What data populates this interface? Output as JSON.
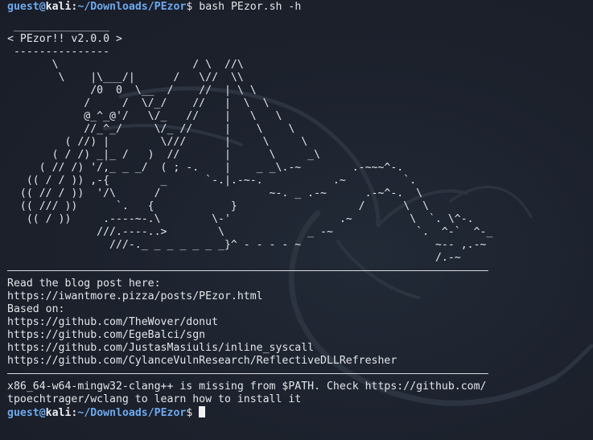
{
  "prompt": {
    "user": "guest",
    "at": "@",
    "host": "kali",
    "sep": ":",
    "path": "~/Downloads/PEzor",
    "symbol": "$"
  },
  "command": " bash PEzor.sh -h",
  "banner_art": " _______________\n< PEzor!! v2.0.0 >\n ---------------\n       \\                     / \\  //\\\n        \\    |\\___/|      /   \\//  \\\\\n             /0  0  \\__  /    //  | \\ \\\n            /     /  \\/_/    //   |  \\  \\\n            @_^_@'/   \\/_   //    |   \\   \\\n            //_^_/     \\/_ //     |    \\    \\\n         ( //) |        \\///      |     \\     \\\n       ( / /) _|_ /   )  //       |      \\     _\\\n     ( // /) '/,_ _ _/  ( ; -.    |    _ _\\.-~        .-~~~^-.\n   (( / / )) ,-{        _      `-.|.-~-.           .~         `.\n  (( // / ))  '/\\      /                 ~-. _ .-~      .-~^-.  \\\n  (( /// ))      `.   {            }                   /      \\  \\\n   (( / ))     .----~-.\\        \\-'                 .~         \\  `. \\^-.\n              ///.----..>        \\             _ -~             `.  ^-`  ^-_\n                ///-._ _ _ _ _ _ _}^ - - - - ~                     ~-- ,.-~\n                                                                   /.-~",
  "blog_header": "Read the blog post here:",
  "blog_url": "https://iwantmore.pizza/posts/PEzor.html",
  "based_on_label": "Based on:",
  "based_on": [
    "https://github.com/TheWover/donut",
    "https://github.com/EgeBalci/sgn",
    "https://github.com/JustasMasiulis/inline_syscall",
    "https://github.com/CylanceVulnResearch/ReflectiveDLLRefresher"
  ],
  "error_line_1": "x86_64-w64-mingw32-clang++ is missing from $PATH. Check https://github.com/",
  "error_line_2": "tpoechtrager/wclang to learn how to install it",
  "colors": {
    "background": "#1b202b",
    "prompt_blue": "#6ea9ef",
    "text": "#e3e5e8"
  }
}
